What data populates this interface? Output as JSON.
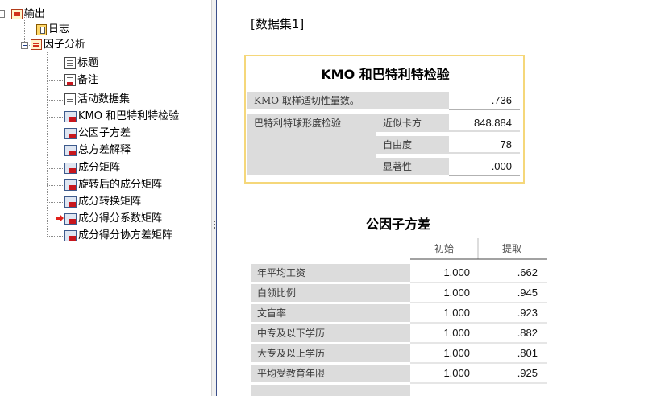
{
  "tree": {
    "root": "输出",
    "log": "日志",
    "group": "因子分析",
    "items": [
      "标题",
      "备注",
      "活动数据集",
      "KMO 和巴特利特检验",
      "公因子方差",
      "总方差解释",
      "成分矩阵",
      "旋转后的成分矩阵",
      "成分转换矩阵",
      "成分得分系数矩阵",
      "成分得分协方差矩阵"
    ]
  },
  "content": {
    "dataset": "[数据集1]",
    "kmo": {
      "title": "KMO 和巴特利特检验",
      "row1_label": "KMO 取样适切性量数。",
      "row1_value": ".736",
      "bartlett_label": "巴特利特球形度检验",
      "chi_label": "近似卡方",
      "chi_value": "848.884",
      "df_label": "自由度",
      "df_value": "78",
      "sig_label": "显著性",
      "sig_value": ".000"
    },
    "communalities": {
      "title": "公因子方差",
      "col_initial": "初始",
      "col_extract": "提取",
      "rows": [
        {
          "label": "年平均工资",
          "initial": "1.000",
          "extract": ".662"
        },
        {
          "label": "白领比例",
          "initial": "1.000",
          "extract": ".945"
        },
        {
          "label": "文盲率",
          "initial": "1.000",
          "extract": ".923"
        },
        {
          "label": "中专及以下学历",
          "initial": "1.000",
          "extract": ".882"
        },
        {
          "label": "大专及以上学历",
          "initial": "1.000",
          "extract": ".801"
        },
        {
          "label": "平均受教育年限",
          "initial": "1.000",
          "extract": ".925"
        }
      ]
    }
  },
  "colors": {
    "frame_highlight": "#f5d77a",
    "label_bg": "#dcdcdc",
    "divider_border": "#3b4f8a",
    "arrow": "#e0201a"
  }
}
